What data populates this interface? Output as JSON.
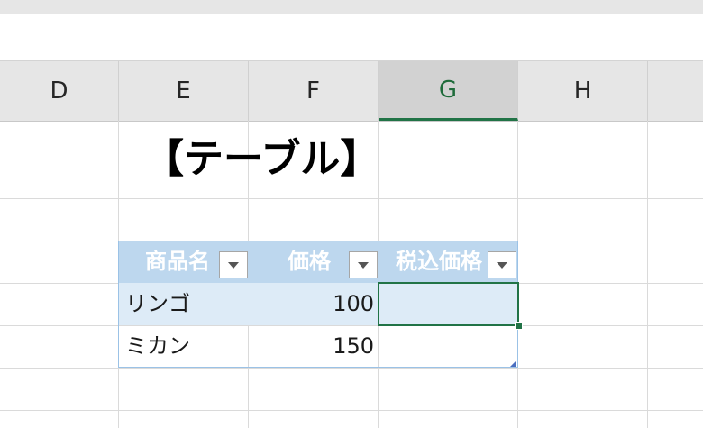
{
  "columns": [
    {
      "letter": "D"
    },
    {
      "letter": "E"
    },
    {
      "letter": "F"
    },
    {
      "letter": "G"
    },
    {
      "letter": "H"
    }
  ],
  "title": "【テーブル】",
  "table": {
    "headers": [
      "商品名",
      "価格",
      "税込価格"
    ],
    "rows": [
      {
        "name": "リンゴ",
        "price": "100",
        "tax_price": ""
      },
      {
        "name": "ミカン",
        "price": "150",
        "tax_price": ""
      }
    ]
  },
  "colors": {
    "header_fill": "#bdd7ee",
    "band_fill": "#ddebf7",
    "selection": "#217346"
  }
}
